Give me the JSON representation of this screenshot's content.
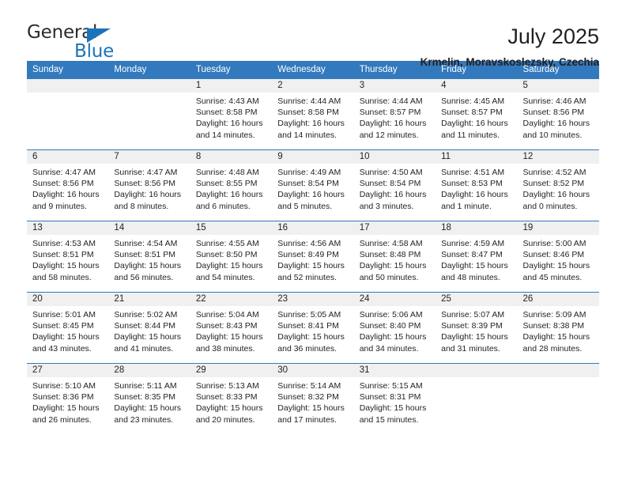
{
  "logo": {
    "word_one": "General",
    "word_two": "Blue",
    "flag_icon": "triangle-flag-icon",
    "brand_color": "#1b74bb"
  },
  "header": {
    "title": "July 2025",
    "subtitle": "Krmelin, Moravskoslezsky, Czechia"
  },
  "theme": {
    "header_blue": "#3279bd",
    "daynum_gray": "#f0f0f0",
    "text": "#231f20"
  },
  "calendar": {
    "weekday_headers": [
      "Sunday",
      "Monday",
      "Tuesday",
      "Wednesday",
      "Thursday",
      "Friday",
      "Saturday"
    ],
    "weeks": [
      [
        {
          "day": "",
          "lines": []
        },
        {
          "day": "",
          "lines": []
        },
        {
          "day": "1",
          "lines": [
            "Sunrise: 4:43 AM",
            "Sunset: 8:58 PM",
            "Daylight: 16 hours",
            "and 14 minutes."
          ]
        },
        {
          "day": "2",
          "lines": [
            "Sunrise: 4:44 AM",
            "Sunset: 8:58 PM",
            "Daylight: 16 hours",
            "and 14 minutes."
          ]
        },
        {
          "day": "3",
          "lines": [
            "Sunrise: 4:44 AM",
            "Sunset: 8:57 PM",
            "Daylight: 16 hours",
            "and 12 minutes."
          ]
        },
        {
          "day": "4",
          "lines": [
            "Sunrise: 4:45 AM",
            "Sunset: 8:57 PM",
            "Daylight: 16 hours",
            "and 11 minutes."
          ]
        },
        {
          "day": "5",
          "lines": [
            "Sunrise: 4:46 AM",
            "Sunset: 8:56 PM",
            "Daylight: 16 hours",
            "and 10 minutes."
          ]
        }
      ],
      [
        {
          "day": "6",
          "lines": [
            "Sunrise: 4:47 AM",
            "Sunset: 8:56 PM",
            "Daylight: 16 hours",
            "and 9 minutes."
          ]
        },
        {
          "day": "7",
          "lines": [
            "Sunrise: 4:47 AM",
            "Sunset: 8:56 PM",
            "Daylight: 16 hours",
            "and 8 minutes."
          ]
        },
        {
          "day": "8",
          "lines": [
            "Sunrise: 4:48 AM",
            "Sunset: 8:55 PM",
            "Daylight: 16 hours",
            "and 6 minutes."
          ]
        },
        {
          "day": "9",
          "lines": [
            "Sunrise: 4:49 AM",
            "Sunset: 8:54 PM",
            "Daylight: 16 hours",
            "and 5 minutes."
          ]
        },
        {
          "day": "10",
          "lines": [
            "Sunrise: 4:50 AM",
            "Sunset: 8:54 PM",
            "Daylight: 16 hours",
            "and 3 minutes."
          ]
        },
        {
          "day": "11",
          "lines": [
            "Sunrise: 4:51 AM",
            "Sunset: 8:53 PM",
            "Daylight: 16 hours",
            "and 1 minute."
          ]
        },
        {
          "day": "12",
          "lines": [
            "Sunrise: 4:52 AM",
            "Sunset: 8:52 PM",
            "Daylight: 16 hours",
            "and 0 minutes."
          ]
        }
      ],
      [
        {
          "day": "13",
          "lines": [
            "Sunrise: 4:53 AM",
            "Sunset: 8:51 PM",
            "Daylight: 15 hours",
            "and 58 minutes."
          ]
        },
        {
          "day": "14",
          "lines": [
            "Sunrise: 4:54 AM",
            "Sunset: 8:51 PM",
            "Daylight: 15 hours",
            "and 56 minutes."
          ]
        },
        {
          "day": "15",
          "lines": [
            "Sunrise: 4:55 AM",
            "Sunset: 8:50 PM",
            "Daylight: 15 hours",
            "and 54 minutes."
          ]
        },
        {
          "day": "16",
          "lines": [
            "Sunrise: 4:56 AM",
            "Sunset: 8:49 PM",
            "Daylight: 15 hours",
            "and 52 minutes."
          ]
        },
        {
          "day": "17",
          "lines": [
            "Sunrise: 4:58 AM",
            "Sunset: 8:48 PM",
            "Daylight: 15 hours",
            "and 50 minutes."
          ]
        },
        {
          "day": "18",
          "lines": [
            "Sunrise: 4:59 AM",
            "Sunset: 8:47 PM",
            "Daylight: 15 hours",
            "and 48 minutes."
          ]
        },
        {
          "day": "19",
          "lines": [
            "Sunrise: 5:00 AM",
            "Sunset: 8:46 PM",
            "Daylight: 15 hours",
            "and 45 minutes."
          ]
        }
      ],
      [
        {
          "day": "20",
          "lines": [
            "Sunrise: 5:01 AM",
            "Sunset: 8:45 PM",
            "Daylight: 15 hours",
            "and 43 minutes."
          ]
        },
        {
          "day": "21",
          "lines": [
            "Sunrise: 5:02 AM",
            "Sunset: 8:44 PM",
            "Daylight: 15 hours",
            "and 41 minutes."
          ]
        },
        {
          "day": "22",
          "lines": [
            "Sunrise: 5:04 AM",
            "Sunset: 8:43 PM",
            "Daylight: 15 hours",
            "and 38 minutes."
          ]
        },
        {
          "day": "23",
          "lines": [
            "Sunrise: 5:05 AM",
            "Sunset: 8:41 PM",
            "Daylight: 15 hours",
            "and 36 minutes."
          ]
        },
        {
          "day": "24",
          "lines": [
            "Sunrise: 5:06 AM",
            "Sunset: 8:40 PM",
            "Daylight: 15 hours",
            "and 34 minutes."
          ]
        },
        {
          "day": "25",
          "lines": [
            "Sunrise: 5:07 AM",
            "Sunset: 8:39 PM",
            "Daylight: 15 hours",
            "and 31 minutes."
          ]
        },
        {
          "day": "26",
          "lines": [
            "Sunrise: 5:09 AM",
            "Sunset: 8:38 PM",
            "Daylight: 15 hours",
            "and 28 minutes."
          ]
        }
      ],
      [
        {
          "day": "27",
          "lines": [
            "Sunrise: 5:10 AM",
            "Sunset: 8:36 PM",
            "Daylight: 15 hours",
            "and 26 minutes."
          ]
        },
        {
          "day": "28",
          "lines": [
            "Sunrise: 5:11 AM",
            "Sunset: 8:35 PM",
            "Daylight: 15 hours",
            "and 23 minutes."
          ]
        },
        {
          "day": "29",
          "lines": [
            "Sunrise: 5:13 AM",
            "Sunset: 8:33 PM",
            "Daylight: 15 hours",
            "and 20 minutes."
          ]
        },
        {
          "day": "30",
          "lines": [
            "Sunrise: 5:14 AM",
            "Sunset: 8:32 PM",
            "Daylight: 15 hours",
            "and 17 minutes."
          ]
        },
        {
          "day": "31",
          "lines": [
            "Sunrise: 5:15 AM",
            "Sunset: 8:31 PM",
            "Daylight: 15 hours",
            "and 15 minutes."
          ]
        },
        {
          "day": "",
          "lines": []
        },
        {
          "day": "",
          "lines": []
        }
      ]
    ]
  }
}
